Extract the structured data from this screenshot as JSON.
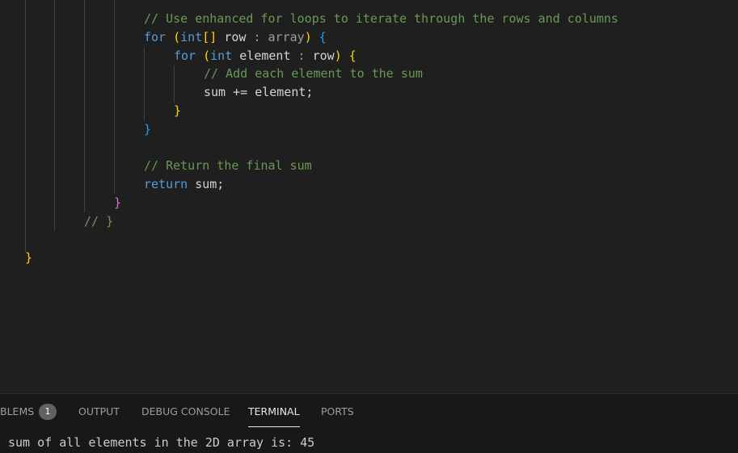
{
  "editor": {
    "lines": [
      [
        {
          "t": "// Use enhanced for loops to iterate through the rows and columns",
          "c": "comment"
        }
      ],
      [
        {
          "t": "for",
          "c": "keyword"
        },
        {
          "t": " ",
          "c": "plain"
        },
        {
          "t": "(",
          "c": "gold"
        },
        {
          "t": "int",
          "c": "keyword"
        },
        {
          "t": "[]",
          "c": "gold"
        },
        {
          "t": " row ",
          "c": "plain"
        },
        {
          "t": ": array",
          "c": "dim"
        },
        {
          "t": ")",
          "c": "gold"
        },
        {
          "t": " ",
          "c": "plain"
        },
        {
          "t": "{",
          "c": "blue"
        }
      ],
      [
        {
          "t": "for",
          "c": "keyword"
        },
        {
          "t": " ",
          "c": "plain"
        },
        {
          "t": "(",
          "c": "gold"
        },
        {
          "t": "int",
          "c": "keyword"
        },
        {
          "t": " element ",
          "c": "plain"
        },
        {
          "t": ":",
          "c": "dim"
        },
        {
          "t": " row",
          "c": "plain"
        },
        {
          "t": ")",
          "c": "gold"
        },
        {
          "t": " ",
          "c": "plain"
        },
        {
          "t": "{",
          "c": "gold"
        }
      ],
      [
        {
          "t": "// Add each element to the sum",
          "c": "comment"
        }
      ],
      [
        {
          "t": "sum += element;",
          "c": "plain"
        }
      ],
      [
        {
          "t": "}",
          "c": "gold"
        }
      ],
      [
        {
          "t": "}",
          "c": "blue"
        }
      ],
      [],
      [
        {
          "t": "// Return the final sum",
          "c": "comment"
        }
      ],
      [
        {
          "t": "return",
          "c": "keyword"
        },
        {
          "t": " sum;",
          "c": "plain"
        }
      ],
      [
        {
          "t": "}",
          "c": "pink"
        }
      ],
      [
        {
          "t": "// }",
          "c": "comment"
        }
      ],
      [],
      [
        {
          "t": "}",
          "c": "gold"
        }
      ]
    ]
  },
  "panel": {
    "tabs": [
      {
        "label": "BLEMS",
        "badge": "1"
      },
      {
        "label": "OUTPUT"
      },
      {
        "label": "DEBUG CONSOLE"
      },
      {
        "label": "TERMINAL",
        "active": true
      },
      {
        "label": "PORTS"
      }
    ],
    "terminal_output": "sum of all elements in the 2D array is: 45"
  },
  "colors": {
    "background": "#1f1f1f",
    "comment": "#6a9955",
    "keyword": "#569cd6",
    "bracket_gold": "#ffd700",
    "bracket_pink": "#da70d6",
    "bracket_blue": "#179fff"
  }
}
